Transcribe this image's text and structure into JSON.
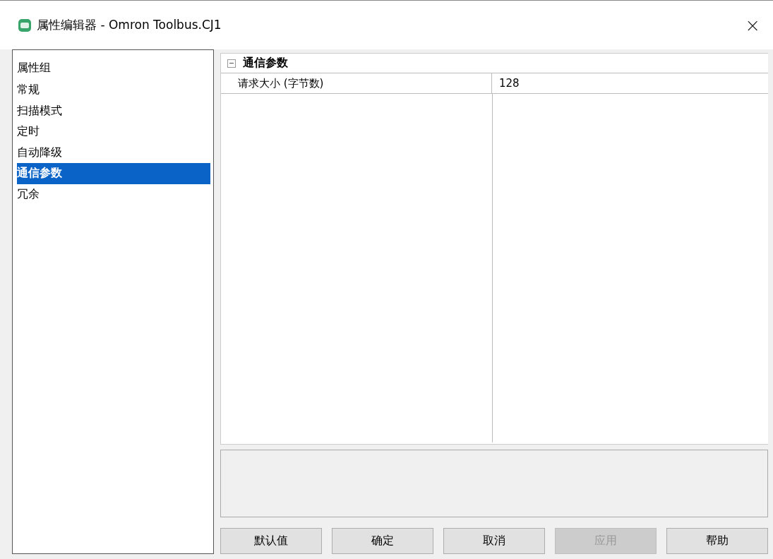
{
  "window": {
    "title": "属性编辑器 - Omron Toolbus.CJ1",
    "close": "×"
  },
  "sidebar": {
    "header": "属性组",
    "items": [
      {
        "label": "常规",
        "selected": false
      },
      {
        "label": "扫描模式",
        "selected": false
      },
      {
        "label": "定时",
        "selected": false
      },
      {
        "label": "自动降级",
        "selected": false
      },
      {
        "label": "通信参数",
        "selected": true
      },
      {
        "label": "冗余",
        "selected": false
      }
    ]
  },
  "property_grid": {
    "categories": [
      {
        "name": "通信参数",
        "expanded": true,
        "properties": [
          {
            "name": "请求大小 (字节数)",
            "value": "128"
          }
        ]
      }
    ]
  },
  "buttons": [
    {
      "label": "默认值",
      "disabled": false
    },
    {
      "label": "确定",
      "disabled": false
    },
    {
      "label": "取消",
      "disabled": false
    },
    {
      "label": "应用",
      "disabled": true
    },
    {
      "label": "帮助",
      "disabled": false
    }
  ]
}
